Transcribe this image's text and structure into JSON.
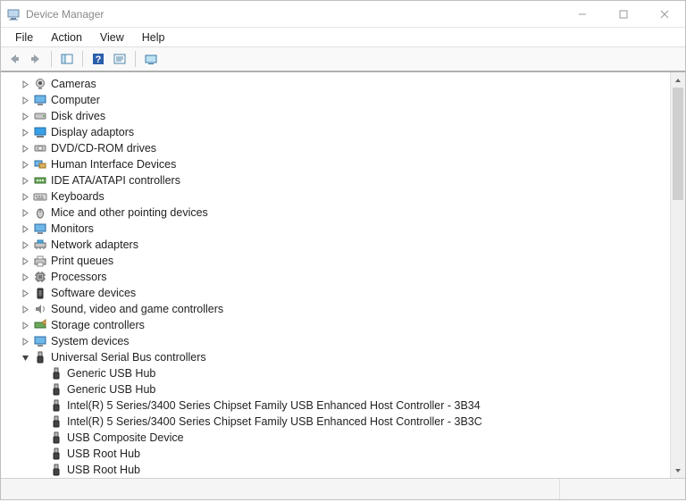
{
  "window": {
    "title": "Device Manager"
  },
  "menu": {
    "file": "File",
    "action": "Action",
    "view": "View",
    "help": "Help"
  },
  "tree": {
    "categories": [
      {
        "label": "Cameras",
        "icon": "camera"
      },
      {
        "label": "Computer",
        "icon": "monitor"
      },
      {
        "label": "Disk drives",
        "icon": "disk"
      },
      {
        "label": "Display adaptors",
        "icon": "display"
      },
      {
        "label": "DVD/CD-ROM drives",
        "icon": "cd"
      },
      {
        "label": "Human Interface Devices",
        "icon": "hid"
      },
      {
        "label": "IDE ATA/ATAPI controllers",
        "icon": "ide"
      },
      {
        "label": "Keyboards",
        "icon": "keyboard"
      },
      {
        "label": "Mice and other pointing devices",
        "icon": "mouse"
      },
      {
        "label": "Monitors",
        "icon": "monitor"
      },
      {
        "label": "Network adapters",
        "icon": "network"
      },
      {
        "label": "Print queues",
        "icon": "printer"
      },
      {
        "label": "Processors",
        "icon": "cpu"
      },
      {
        "label": "Software devices",
        "icon": "software"
      },
      {
        "label": "Sound, video and game controllers",
        "icon": "sound"
      },
      {
        "label": "Storage controllers",
        "icon": "storage"
      },
      {
        "label": "System devices",
        "icon": "system"
      },
      {
        "label": "Universal Serial Bus controllers",
        "icon": "usb",
        "expanded": true
      }
    ],
    "usb_children": [
      {
        "label": "Generic USB Hub"
      },
      {
        "label": "Generic USB Hub"
      },
      {
        "label": "Intel(R) 5 Series/3400 Series Chipset Family USB Enhanced Host Controller - 3B34"
      },
      {
        "label": "Intel(R) 5 Series/3400 Series Chipset Family USB Enhanced Host Controller - 3B3C"
      },
      {
        "label": "USB Composite Device"
      },
      {
        "label": "USB Root Hub"
      },
      {
        "label": "USB Root Hub"
      }
    ]
  }
}
